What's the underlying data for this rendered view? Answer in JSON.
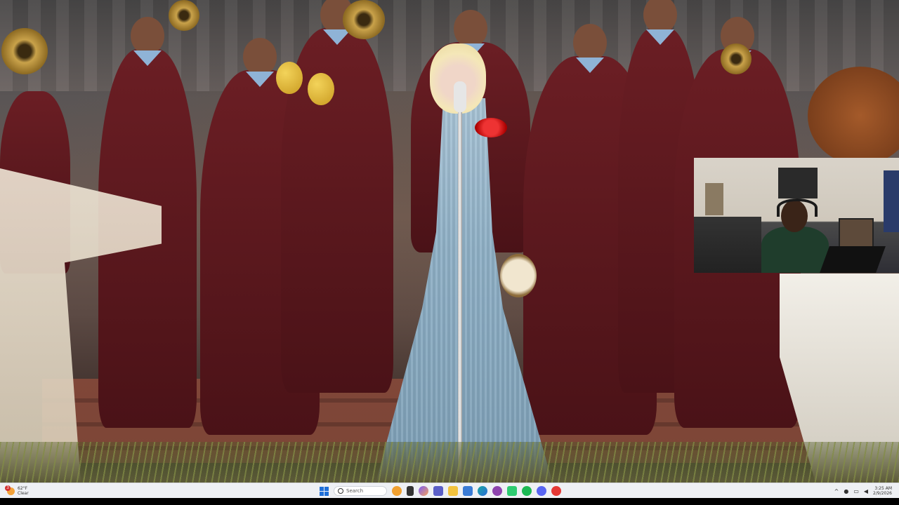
{
  "taskbar": {
    "weather": {
      "badge": "3",
      "temp": "62°F",
      "condition": "Clear"
    },
    "search": {
      "placeholder": "Search"
    },
    "apps": [
      {
        "name": "pizza-app-icon",
        "color": "#f0a030"
      },
      {
        "name": "file-app-icon",
        "color": "#333333"
      },
      {
        "name": "copilot-icon",
        "color": "#7b5cf5"
      },
      {
        "name": "teams-icon",
        "color": "#5b5fc7"
      },
      {
        "name": "file-explorer-icon",
        "color": "#f3c33e"
      },
      {
        "name": "store-icon",
        "color": "#3a7bd5"
      },
      {
        "name": "edge-icon",
        "color": "#1aa7a1"
      },
      {
        "name": "app-purple-icon",
        "color": "#8e44ad"
      },
      {
        "name": "app-green-icon",
        "color": "#2ecc71"
      },
      {
        "name": "spotify-icon",
        "color": "#1db954"
      },
      {
        "name": "discord-icon",
        "color": "#5865f2"
      },
      {
        "name": "app-red-icon",
        "color": "#e53935"
      }
    ],
    "tray": {
      "chevron": "^",
      "clock_time": "3:25 AM",
      "clock_date": "2/9/2026"
    }
  }
}
